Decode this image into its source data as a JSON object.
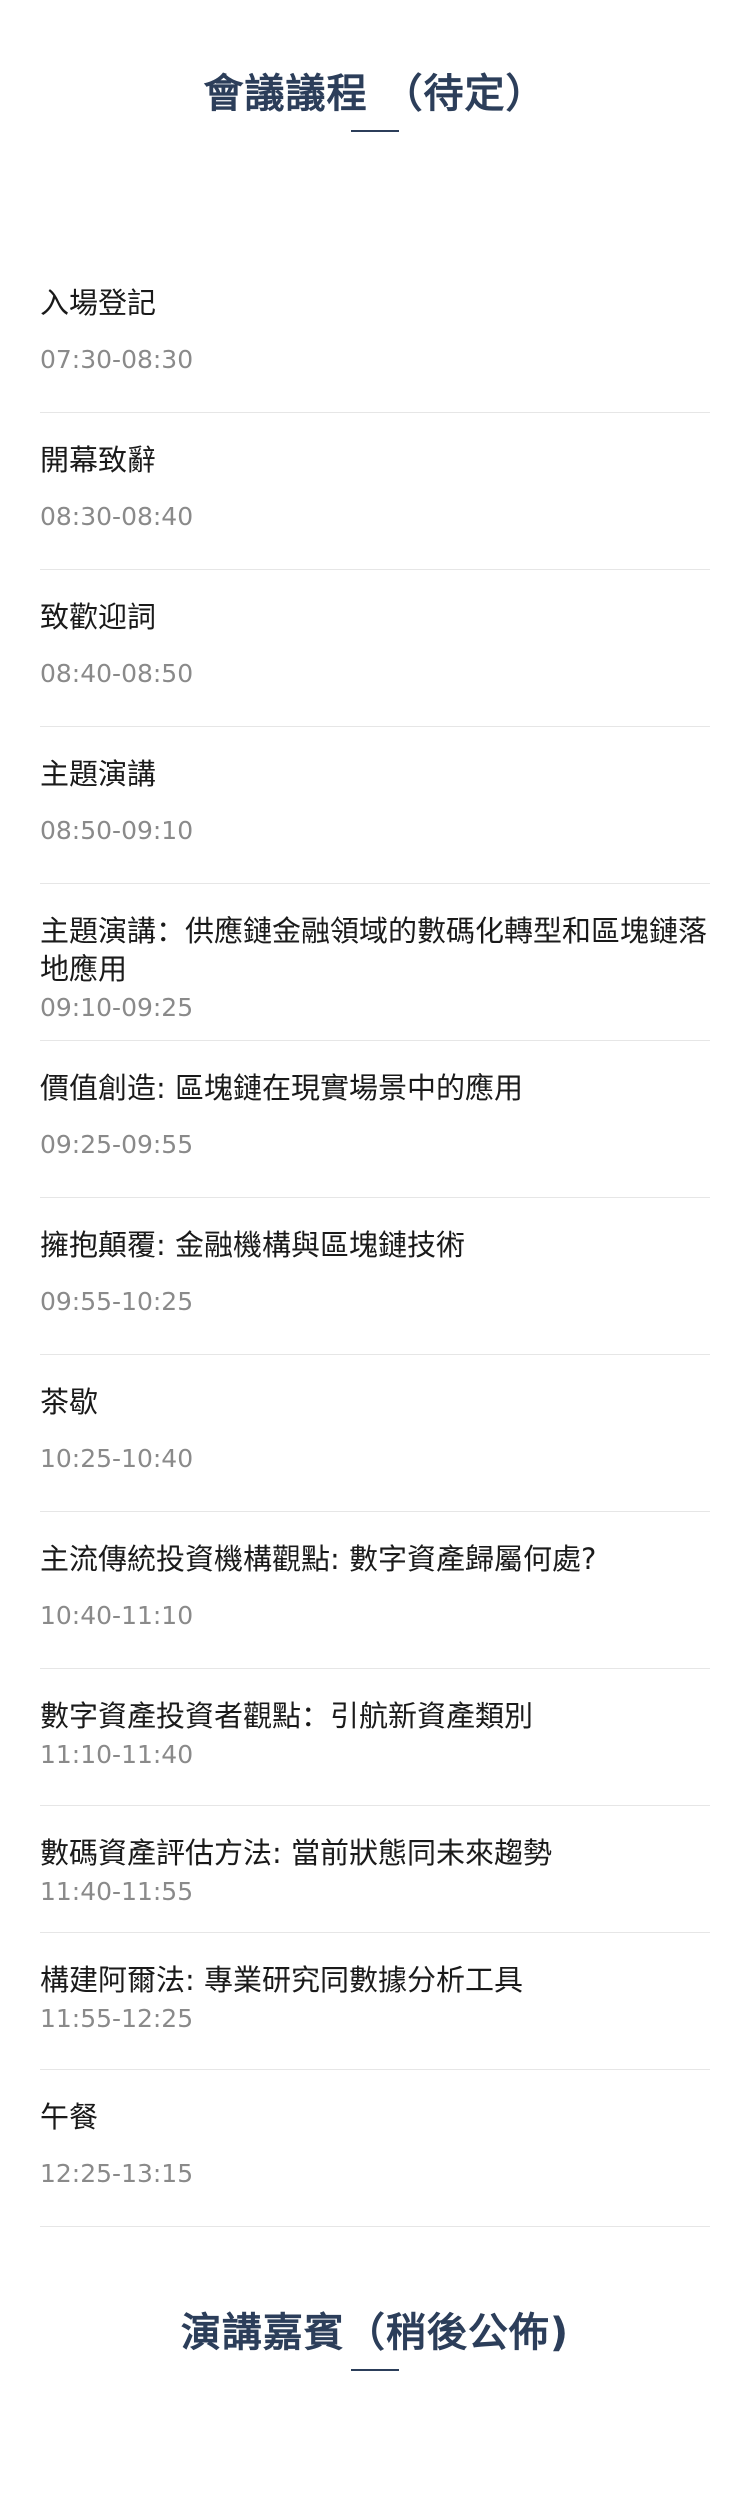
{
  "agenda": {
    "title": "會議議程 （待定）",
    "items": [
      {
        "title": "入場登記",
        "time": "07:30-08:30"
      },
      {
        "title": "開幕致辭",
        "time": "08:30-08:40"
      },
      {
        "title": "致歡迎詞",
        "time": "08:40-08:50"
      },
      {
        "title": "主題演講",
        "time": "08:50-09:10"
      },
      {
        "title": "主題演講：供應鏈金融領域的數碼化轉型和區塊鏈落地應用",
        "time": "09:10-09:25"
      },
      {
        "title": "價值創造: 區塊鏈在現實場景中的應用",
        "time": "09:25-09:55"
      },
      {
        "title": "擁抱顛覆: 金融機構與區塊鏈技術",
        "time": "09:55-10:25"
      },
      {
        "title": "茶歇",
        "time": "10:25-10:40"
      },
      {
        "title": "主流傳統投資機構觀點: 數字資產歸屬何處?",
        "time": "10:40-11:10"
      },
      {
        "title": "數字資產投資者觀點：引航新資產類別",
        "time": "11:10-11:40"
      },
      {
        "title": "數碼資產評估方法: 當前狀態同未來趨勢",
        "time": "11:40-11:55"
      },
      {
        "title": "構建阿爾法: 專業研究同數據分析工具",
        "time": "11:55-12:25"
      },
      {
        "title": "午餐",
        "time": "12:25-13:15"
      }
    ]
  },
  "speakers": {
    "title": "演講嘉賓（稍後公佈)"
  }
}
